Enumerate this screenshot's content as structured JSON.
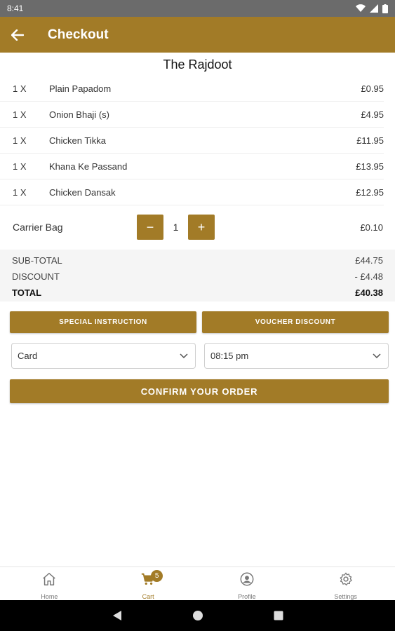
{
  "status_bar": {
    "time": "8:41"
  },
  "app_bar": {
    "title": "Checkout"
  },
  "restaurant_name": "The Rajdoot",
  "order_items": [
    {
      "qty": "1 X",
      "name": "Plain Papadom",
      "price": "£0.95"
    },
    {
      "qty": "1 X",
      "name": "Onion Bhaji (s)",
      "price": "£4.95"
    },
    {
      "qty": "1 X",
      "name": "Chicken Tikka",
      "price": "£11.95"
    },
    {
      "qty": "1 X",
      "name": "Khana Ke Passand",
      "price": "£13.95"
    },
    {
      "qty": "1 X",
      "name": "Chicken Dansak",
      "price": "£12.95"
    }
  ],
  "carrier_bag": {
    "label": "Carrier Bag",
    "minus": "−",
    "quantity": "1",
    "plus": "+",
    "price": "£0.10"
  },
  "totals": {
    "subtotal_label": "SUB-TOTAL",
    "subtotal_value": "£44.75",
    "discount_label": "DISCOUNT",
    "discount_value": "- £4.48",
    "total_label": "TOTAL",
    "total_value": "£40.38"
  },
  "buttons": {
    "special_instruction": "SPECIAL INSTRUCTION",
    "voucher_discount": "VOUCHER DISCOUNT",
    "confirm_order": "CONFIRM YOUR ORDER"
  },
  "payment_select": {
    "value": "Card",
    "icon": "chevron-down-icon"
  },
  "time_select": {
    "value": "08:15 pm",
    "icon": "chevron-down-icon"
  },
  "bottom_nav": {
    "items": [
      {
        "label": "Home",
        "icon": "home-icon"
      },
      {
        "label": "Cart",
        "icon": "cart-icon",
        "badge": "5",
        "active": true
      },
      {
        "label": "Profile",
        "icon": "profile-icon"
      },
      {
        "label": "Settings",
        "icon": "gear-icon"
      }
    ]
  },
  "colors": {
    "accent": "#a27b27",
    "status_bar": "#6b6b6b",
    "totals_background": "#f5f5f5"
  }
}
